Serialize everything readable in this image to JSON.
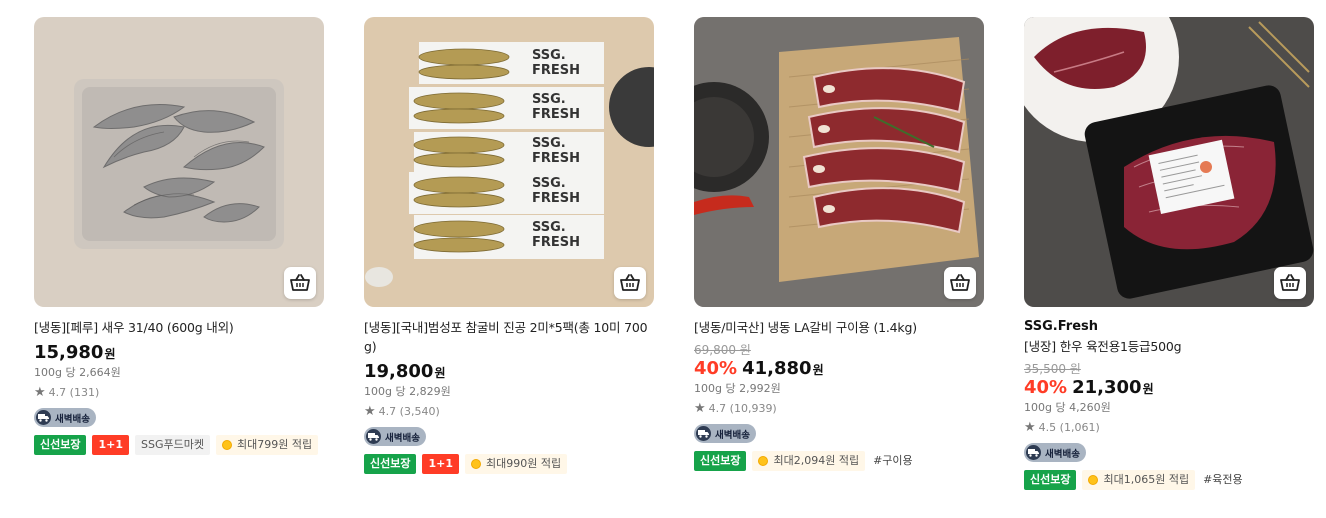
{
  "products": [
    {
      "brand": "",
      "title": "[냉동][페루] 새우 31/40 (600g 내외)",
      "original_price": "",
      "discount": "",
      "price": "15,980",
      "currency": "원",
      "unit_price": "100g 당 2,664원",
      "rating": "4.7",
      "reviews": "(131)",
      "delivery_badge": "새벽배송",
      "badges": [
        "신선보장",
        "1+1",
        "SSG푸드마켓"
      ],
      "point": "최대799원 적립",
      "tag": ""
    },
    {
      "brand": "",
      "title": "[냉동][국내]범성포 참굴비 진공 2미*5팩(총 10미 700g)",
      "original_price": "",
      "discount": "",
      "price": "19,800",
      "currency": "원",
      "unit_price": "100g 당 2,829원",
      "rating": "4.7",
      "reviews": "(3,540)",
      "delivery_badge": "새벽배송",
      "badges": [
        "신선보장",
        "1+1"
      ],
      "point": "최대990원 적립",
      "tag": ""
    },
    {
      "brand": "",
      "title": "[냉동/미국산] 냉동 LA갈비 구이용 (1.4kg)",
      "original_price": "69,800 원",
      "discount": "40%",
      "price": "41,880",
      "currency": "원",
      "unit_price": "100g 당 2,992원",
      "rating": "4.7",
      "reviews": "(10,939)",
      "delivery_badge": "새벽배송",
      "badges": [
        "신선보장"
      ],
      "point": "최대2,094원 적립",
      "tag": "#구이용"
    },
    {
      "brand": "SSG.Fresh",
      "title": "[냉장] 한우 육전용1등급500g",
      "original_price": "35,500 원",
      "discount": "40%",
      "price": "21,300",
      "currency": "원",
      "unit_price": "100g 당 4,260원",
      "rating": "4.5",
      "reviews": "(1,061)",
      "delivery_badge": "새벽배송",
      "badges": [
        "신선보장"
      ],
      "point": "최대1,065원 적립",
      "tag": "#육전용"
    }
  ],
  "images": {
    "p1": {
      "pack_label": "",
      "description_icon": "shrimp-image"
    },
    "p2": {
      "pack_label_line1": "SSG.",
      "pack_label_line2": "FRESH"
    },
    "p3": {
      "description_icon": "beef-rib-image"
    },
    "p4": {
      "description_icon": "hanwoo-beef-image"
    }
  },
  "icons": {
    "cart": "basket-icon",
    "star": "star-icon",
    "truck": "truck-icon",
    "coin": "coin-icon"
  },
  "colors": {
    "discount": "#ff3c26",
    "fresh_badge": "#16a34a",
    "plus_badge": "#ff3c26",
    "dawn_badge": "#a9b4c2"
  }
}
